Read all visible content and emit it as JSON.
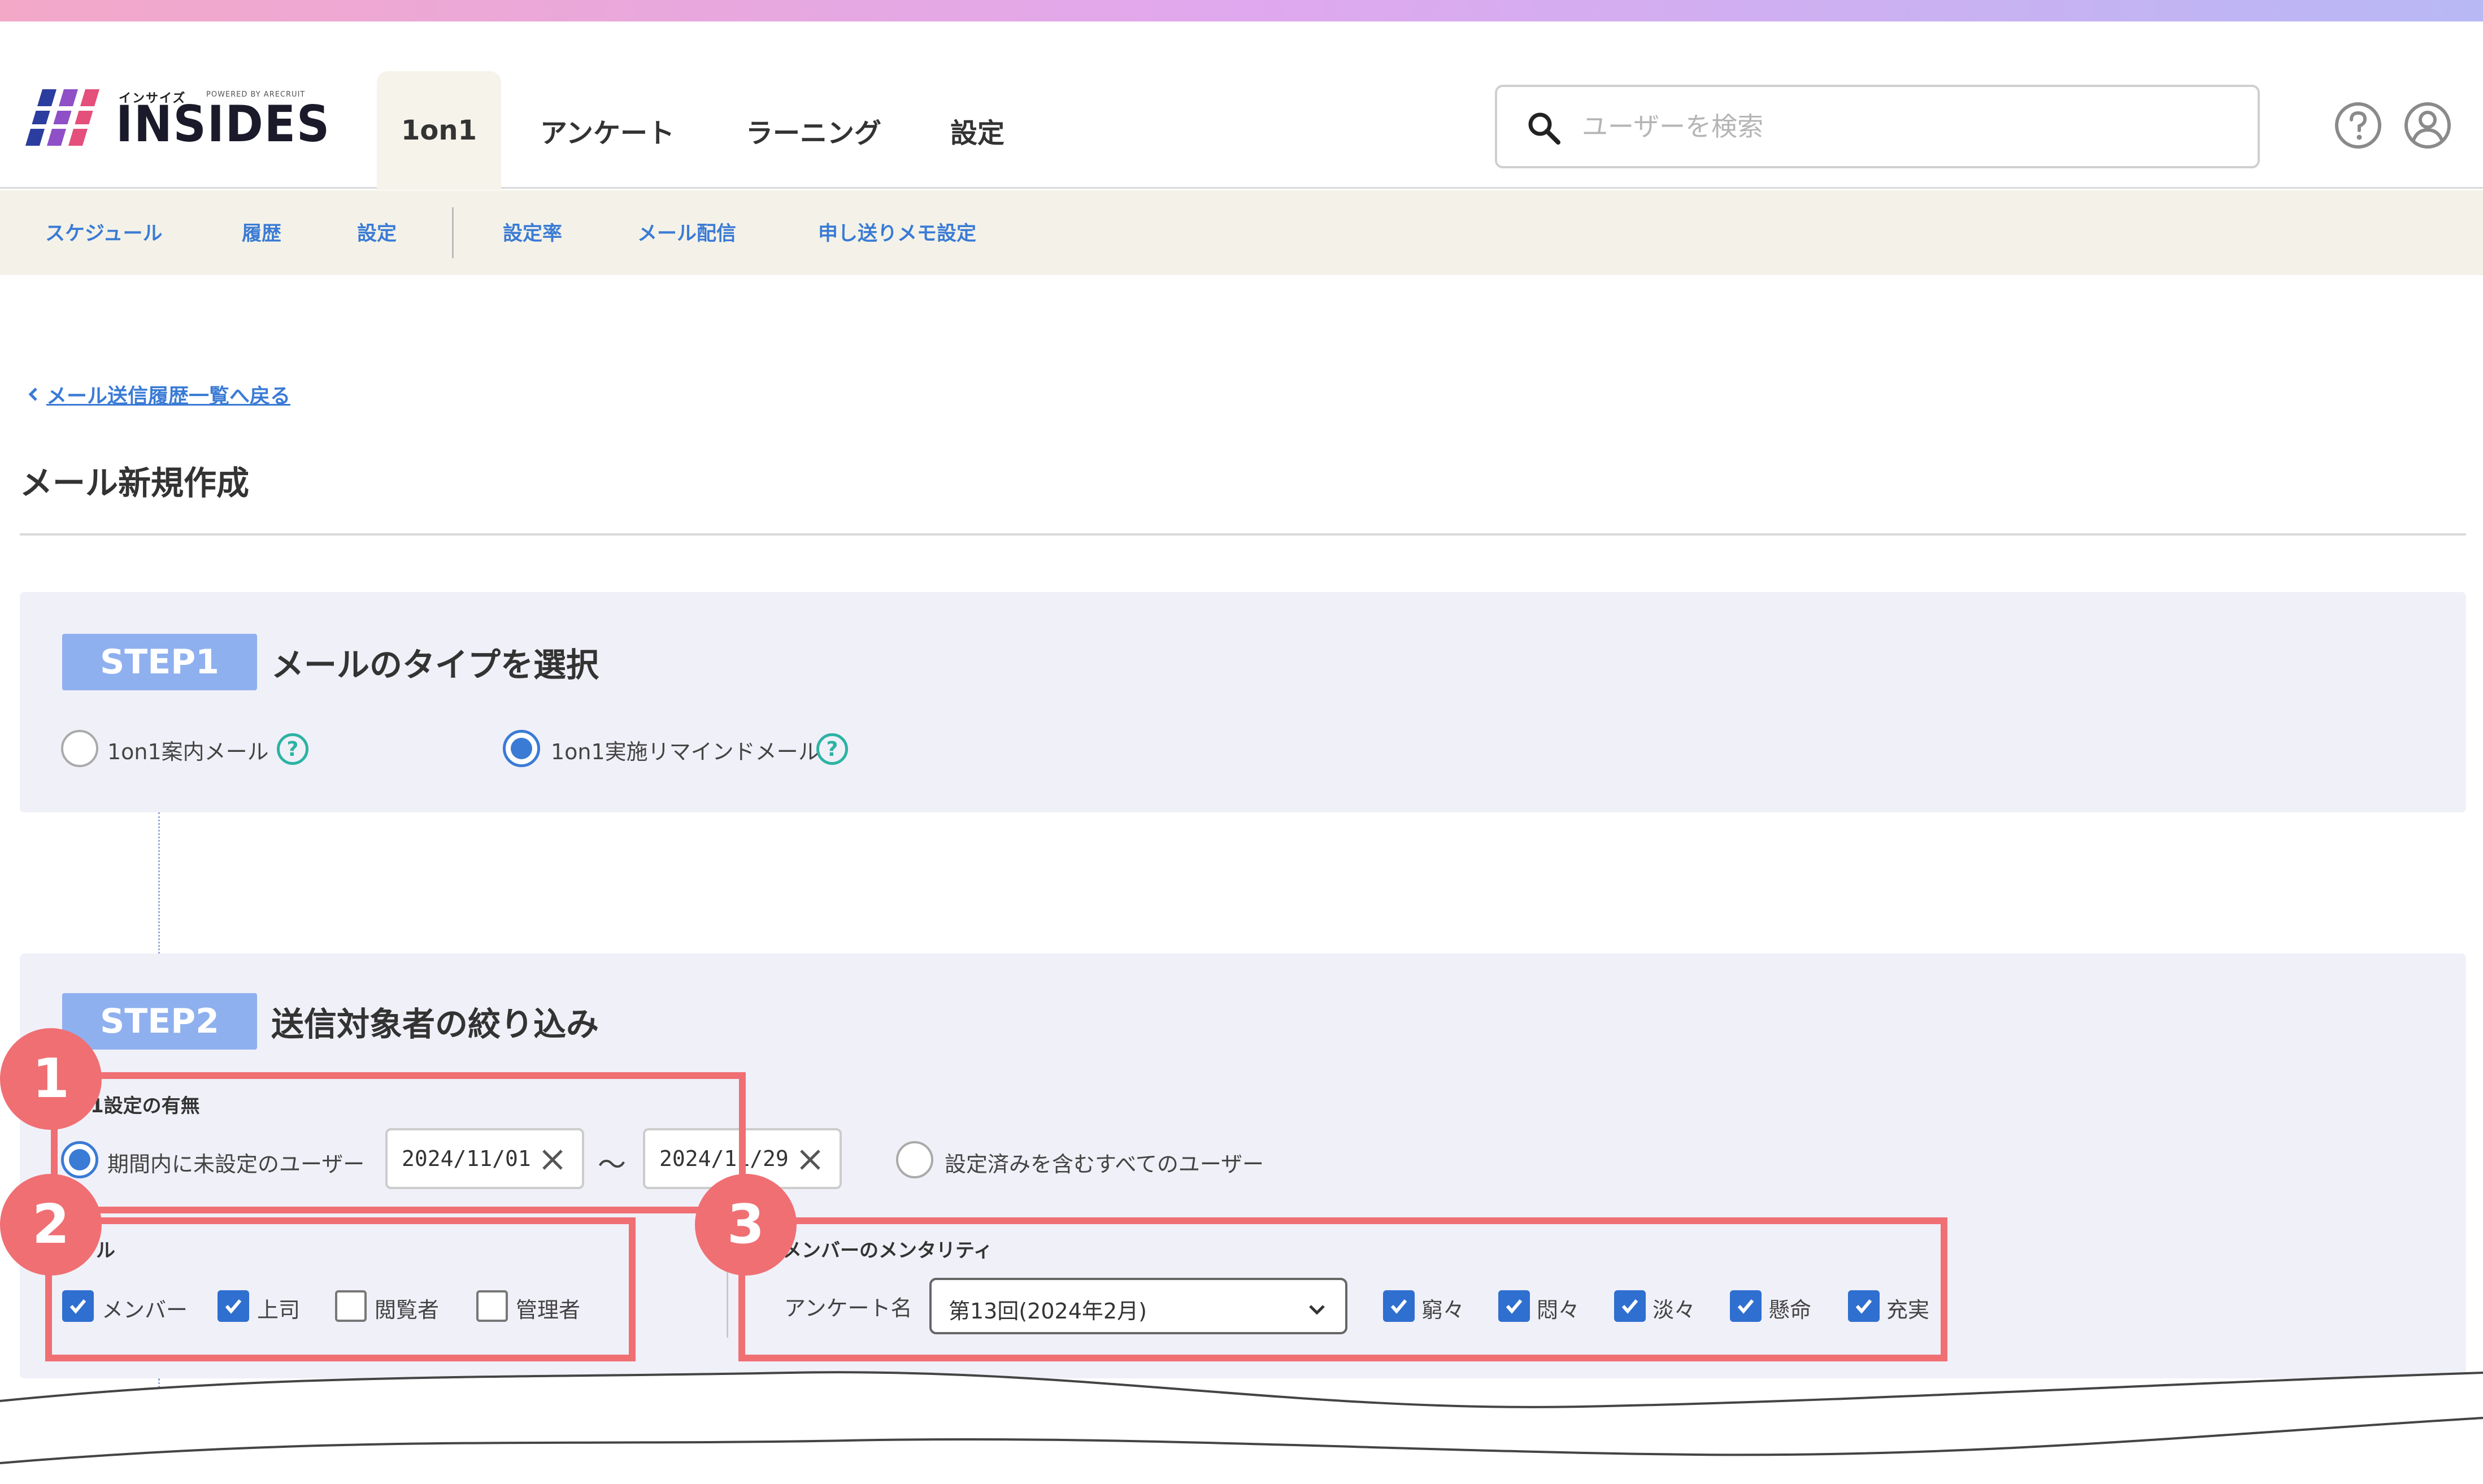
{
  "header": {
    "logo": {
      "kana": "インサイズ",
      "powered": "POWERED BY ARECRUIT",
      "name": "INSIDES"
    },
    "tabs": [
      {
        "label": "1on1",
        "active": true
      },
      {
        "label": "アンケート",
        "active": false
      },
      {
        "label": "ラーニング",
        "active": false
      },
      {
        "label": "設定",
        "active": false
      }
    ],
    "search": {
      "placeholder": "ユーザーを検索",
      "value": ""
    },
    "icons": [
      "search-icon",
      "help-circle-icon",
      "user-profile-icon"
    ]
  },
  "subnav": {
    "items": [
      "スケジュール",
      "履歴",
      "設定",
      "設定率",
      "メール配信",
      "申し送りメモ設定"
    ]
  },
  "breadcrumb": {
    "back_label": "メール送信履歴一覧へ戻る"
  },
  "page": {
    "title": "メール新規作成"
  },
  "step1": {
    "badge": "STEP1",
    "title": "メールのタイプを選択",
    "options": [
      {
        "label": "1on1案内メール",
        "checked": false
      },
      {
        "label": "1on1実施リマインドメール",
        "checked": true
      }
    ]
  },
  "step2": {
    "badge": "STEP2",
    "title": "送信対象者の絞り込み",
    "setting_section": {
      "label": "1設定の有無",
      "option_unset": "期間内に未設定のユーザー",
      "date_from": "2024/11/01",
      "separator": "〜",
      "date_to": "2024/11/29",
      "option_all": "設定済みを含むすべてのユーザー"
    },
    "role_section": {
      "label": "ル",
      "roles": [
        {
          "label": "メンバー",
          "checked": true
        },
        {
          "label": "上司",
          "checked": true
        },
        {
          "label": "閲覧者",
          "checked": false
        },
        {
          "label": "管理者",
          "checked": false
        }
      ]
    },
    "mentality_section": {
      "label": "メンバーのメンタリティ",
      "survey_label": "アンケート名",
      "survey_value": "第13回(2024年2月)",
      "levels": [
        {
          "label": "窮々",
          "checked": true
        },
        {
          "label": "悶々",
          "checked": true
        },
        {
          "label": "淡々",
          "checked": true
        },
        {
          "label": "懸命",
          "checked": true
        },
        {
          "label": "充実",
          "checked": true
        }
      ]
    }
  },
  "annotations": [
    "1",
    "2",
    "3"
  ],
  "colors": {
    "accent": "#3a7bd5",
    "annotation": "#ef6f73",
    "step_badge": "#8fb0ee",
    "panel_bg": "#f0f0f8",
    "subnav_bg": "#f4f2e8"
  }
}
